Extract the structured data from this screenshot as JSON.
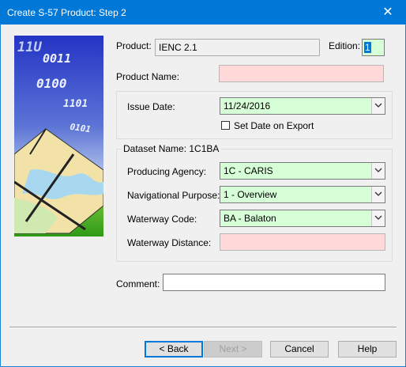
{
  "window": {
    "title": "Create S-57 Product: Step 2",
    "close_glyph": "✕"
  },
  "banner": {
    "binary_lines": [
      "11U",
      "0011",
      "0100",
      "1101",
      "0101"
    ],
    "colors": {
      "sky_top": "#2a3fc8",
      "sky_bottom": "#c6d6ee",
      "land": "#f2e2a8",
      "water": "#a7d8f0",
      "grass": "#44aa22"
    }
  },
  "form": {
    "product_label": "Product:",
    "product_value": "IENC 2.1",
    "edition_label": "Edition:",
    "edition_value": "1",
    "product_name_label": "Product Name:",
    "product_name_value": "",
    "issue_date_label": "Issue Date:",
    "issue_date_value": "11/24/2016",
    "set_date_label": "Set Date on Export",
    "set_date_checked": false,
    "dataset_name_label": "Dataset Name:  1C1BA",
    "producing_agency_label": "Producing Agency:",
    "producing_agency_value": "1C - CARIS",
    "nav_purpose_label": "Navigational Purpose:",
    "nav_purpose_value": "1 - Overview",
    "waterway_code_label": "Waterway Code:",
    "waterway_code_value": "BA - Balaton",
    "waterway_distance_label": "Waterway Distance:",
    "waterway_distance_value": "",
    "comment_label": "Comment:",
    "comment_value": ""
  },
  "buttons": {
    "back": "< Back",
    "next": "Next >",
    "cancel": "Cancel",
    "help": "Help"
  },
  "colors": {
    "title_bar": "#0078d7",
    "required_field": "#ffd9d9",
    "valid_field": "#d7ffd7"
  }
}
